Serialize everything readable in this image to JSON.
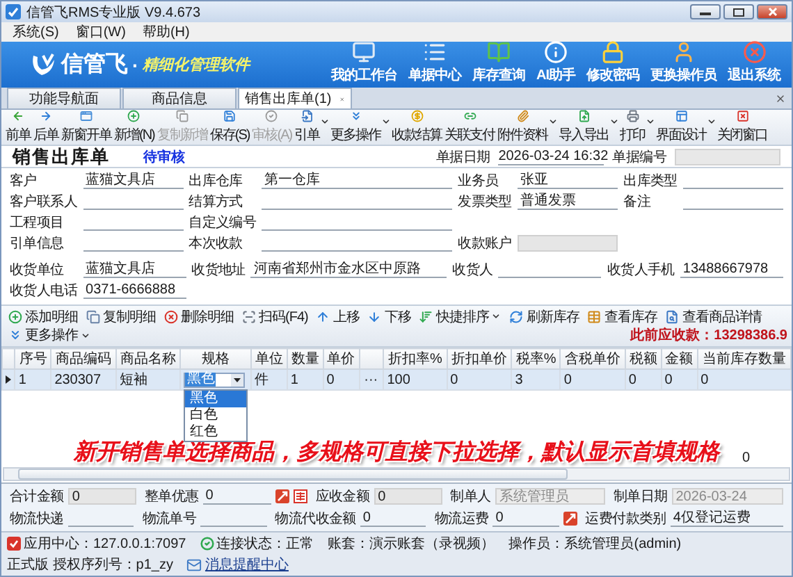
{
  "window": {
    "title": "信管飞RMS专业版 V9.4.673"
  },
  "menu": [
    "系统(S)",
    "窗口(W)",
    "帮助(H)"
  ],
  "banner": {
    "brand": "信管飞",
    "separator": "·",
    "slogan": "精细化管理软件",
    "actions": [
      "我的工作台",
      "单据中心",
      "库存查询",
      "AI助手",
      "修改密码",
      "更换操作员",
      "退出系统"
    ]
  },
  "tabs": [
    {
      "label": "功能导航面",
      "selected": false,
      "closable": false
    },
    {
      "label": "商品信息",
      "selected": false,
      "closable": false
    },
    {
      "label": "销售出库单(1)",
      "selected": true,
      "closable": true
    }
  ],
  "toolbar": [
    {
      "label": "前单",
      "disabled": false,
      "dropdown": false
    },
    {
      "label": "后单",
      "disabled": false,
      "dropdown": false
    },
    {
      "label": "新窗开单",
      "disabled": false,
      "dropdown": false
    },
    {
      "label": "新增(N)",
      "disabled": false,
      "dropdown": false
    },
    {
      "label": "复制新增",
      "disabled": true,
      "dropdown": false
    },
    {
      "label": "保存(S)",
      "disabled": false,
      "dropdown": false
    },
    {
      "label": "审核(A)",
      "disabled": true,
      "dropdown": false
    },
    {
      "label": "引单",
      "disabled": false,
      "dropdown": true
    },
    {
      "label": "更多操作",
      "disabled": false,
      "dropdown": true
    },
    {
      "label": "收款结算",
      "disabled": false,
      "dropdown": false
    },
    {
      "label": "关联支付",
      "disabled": false,
      "dropdown": false
    },
    {
      "label": "附件资料",
      "disabled": false,
      "dropdown": true
    },
    {
      "label": "导入导出",
      "disabled": false,
      "dropdown": true
    },
    {
      "label": "打印",
      "disabled": false,
      "dropdown": true
    },
    {
      "label": "界面设计",
      "disabled": false,
      "dropdown": true
    },
    {
      "label": "关闭窗口",
      "disabled": false,
      "dropdown": false
    }
  ],
  "form": {
    "title": "销售出库单",
    "status": "待审核",
    "date_label": "单据日期",
    "date": "2026-03-24 16:32",
    "number_label": "单据编号",
    "rows": [
      [
        {
          "label": "客户",
          "value": "蓝猫文具店",
          "kind": "line"
        },
        {
          "label": "出库仓库",
          "value": "第一仓库",
          "kind": "line"
        },
        {
          "label": "业务员",
          "value": "张亚",
          "kind": "line"
        },
        {
          "label": "出库类型",
          "kind": "line"
        }
      ],
      [
        {
          "label": "客户联系人",
          "kind": "line"
        },
        {
          "label": "结算方式",
          "kind": "line"
        },
        {
          "label": "发票类型",
          "value": "普通发票",
          "kind": "line"
        },
        {
          "label": "备注",
          "kind": "line"
        }
      ],
      [
        {
          "label": "工程项目",
          "kind": "line"
        },
        {
          "label": "自定义编号",
          "kind": "line"
        },
        null,
        null
      ],
      [
        {
          "label": "引单信息",
          "kind": "line"
        },
        {
          "label": "本次收款",
          "kind": "line"
        },
        {
          "label": "收款账户",
          "kind": "box"
        },
        null
      ]
    ],
    "delivery_rows": [
      [
        {
          "label": "收货单位",
          "value": "蓝猫文具店",
          "kind": "line"
        },
        {
          "label": "收货地址",
          "value": "河南省郑州市金水区中原路",
          "kind": "line"
        },
        {
          "label": "收货人",
          "kind": "line"
        },
        {
          "label": "收货人手机",
          "value": "13488667978",
          "kind": "line"
        }
      ],
      [
        {
          "label": "收货人电话",
          "value": "0371-6666888",
          "kind": "line"
        },
        null,
        null,
        null
      ]
    ]
  },
  "grid_toolbar": {
    "buttons": [
      {
        "label": "添加明细",
        "dropdown": false
      },
      {
        "label": "复制明细",
        "dropdown": false
      },
      {
        "label": "删除明细",
        "dropdown": false
      },
      {
        "label": "扫码(F4)",
        "dropdown": false
      },
      {
        "label": "上移",
        "dropdown": false
      },
      {
        "label": "下移",
        "dropdown": false
      },
      {
        "label": "快捷排序",
        "dropdown": true
      },
      {
        "label": "刷新库存",
        "dropdown": false
      },
      {
        "label": "查看库存",
        "dropdown": false
      },
      {
        "label": "查看商品详情",
        "dropdown": false
      },
      {
        "label": "更多操作",
        "dropdown": true
      }
    ],
    "receivable": "此前应收款：13298386.9"
  },
  "table": {
    "columns": [
      {
        "label": "序号",
        "kind": "text"
      },
      {
        "label": "商品编码",
        "kind": "text"
      },
      {
        "label": "商品名称",
        "kind": "text"
      },
      {
        "label": "规格",
        "kind": "combo"
      },
      {
        "label": "单位",
        "kind": "text"
      },
      {
        "label": "数量",
        "kind": "text"
      },
      {
        "label": "单价",
        "kind": "text"
      },
      {
        "kind": "button"
      },
      {
        "label": "折扣率%",
        "kind": "text"
      },
      {
        "label": "折扣单价",
        "kind": "text"
      },
      {
        "label": "税率%",
        "kind": "text"
      },
      {
        "label": "含税单价",
        "kind": "text"
      },
      {
        "label": "税额",
        "kind": "text"
      },
      {
        "label": "金额",
        "kind": "text"
      },
      {
        "label": "当前库存数量",
        "kind": "text"
      }
    ],
    "rows": [
      {
        "selected": true,
        "cells": [
          "1",
          "230307",
          "短袖",
          "黑色",
          "件",
          "1",
          "0",
          "···",
          "100",
          "0",
          "3",
          "0",
          "0",
          "0",
          "0"
        ],
        "options": [
          {
            "label": "黑色",
            "selected": true
          },
          {
            "label": "白色",
            "selected": false
          },
          {
            "label": "红色",
            "selected": false
          }
        ]
      }
    ],
    "summary": "0"
  },
  "caption": "新开销售单选择商品，多规格可直接下拉选择，默认显示首填规格",
  "footer": {
    "rows": [
      [
        {
          "label": "合计金额",
          "value": "0",
          "kind": "box"
        },
        {
          "label": "整单优惠",
          "value": "0",
          "kind": "line_tools"
        },
        {
          "label": "应收金额",
          "value": "0",
          "kind": "box"
        },
        {
          "label": "制单人",
          "value": "系统管理员",
          "kind": "readonly"
        },
        {
          "label": "制单日期",
          "value": "2026-03-24",
          "kind": "readonly"
        }
      ],
      [
        {
          "label": "物流快递",
          "kind": "line"
        },
        {
          "label": "物流单号",
          "kind": "line"
        },
        {
          "label": "物流代收金额",
          "value": "0",
          "kind": "line"
        },
        {
          "label": "物流运费",
          "value": "0",
          "kind": "line_tool"
        },
        {
          "label": "运费付款类别",
          "value": "4仅登记运费",
          "kind": "line"
        }
      ]
    ]
  },
  "status_bar": [
    {
      "text": "应用中心：127.0.0.1:7097",
      "kind": "app"
    },
    {
      "text": "连接状态：正常",
      "kind": "ok"
    },
    {
      "text": "账套：演示账套（录视频）",
      "kind": "text"
    },
    {
      "text": "操作员：系统管理员(admin)",
      "kind": "text"
    },
    {
      "text": "正式版 授权序列号：p1_zy",
      "kind": "text"
    },
    {
      "text": "消息提醒中心",
      "kind": "link"
    }
  ]
}
